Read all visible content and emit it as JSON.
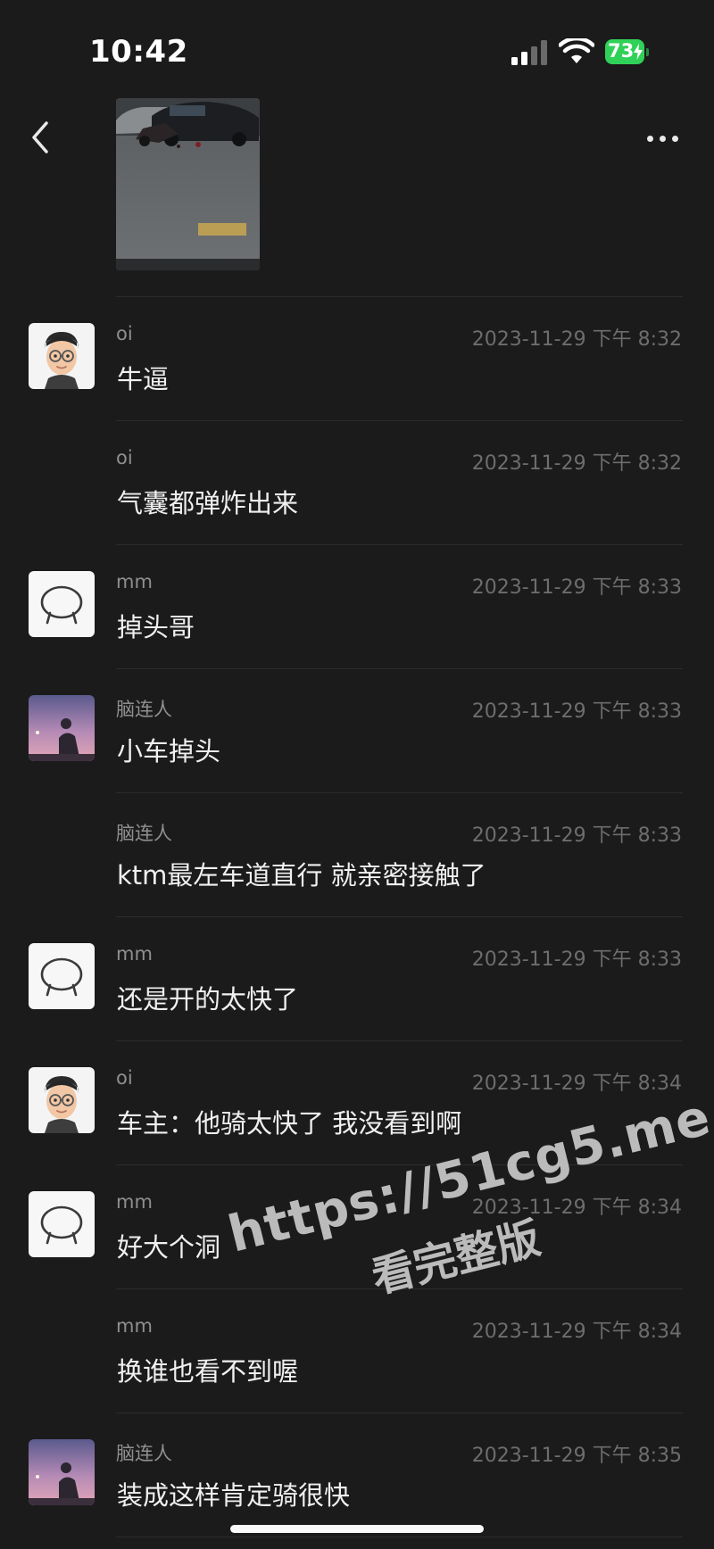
{
  "status_bar": {
    "time": "10:42",
    "battery_percent": "73"
  },
  "header": {
    "back_icon": "chevron-left-icon",
    "more_icon": "ellipsis-icon"
  },
  "post": {
    "image_subject": "car accident scene"
  },
  "comments": [
    {
      "sender": "oi",
      "avatar": "memoji-glasses",
      "timestamp": "2023-11-29 下午 8:32",
      "text": "牛逼",
      "show_avatar": true
    },
    {
      "sender": "oi",
      "avatar": "",
      "timestamp": "2023-11-29 下午 8:32",
      "text": "气囊都弹炸出来",
      "show_avatar": false
    },
    {
      "sender": "mm",
      "avatar": "speech-bubble",
      "timestamp": "2023-11-29 下午 8:33",
      "text": "掉头哥",
      "show_avatar": true
    },
    {
      "sender": "脑连人",
      "avatar": "sunset-photo",
      "timestamp": "2023-11-29 下午 8:33",
      "text": "小车掉头",
      "show_avatar": true
    },
    {
      "sender": "脑连人",
      "avatar": "",
      "timestamp": "2023-11-29 下午 8:33",
      "text": "ktm最左车道直行 就亲密接触了",
      "show_avatar": false
    },
    {
      "sender": "mm",
      "avatar": "speech-bubble",
      "timestamp": "2023-11-29 下午 8:33",
      "text": "还是开的太快了",
      "show_avatar": true
    },
    {
      "sender": "oi",
      "avatar": "memoji-glasses",
      "timestamp": "2023-11-29 下午 8:34",
      "text": "车主：他骑太快了 我没看到啊",
      "show_avatar": true
    },
    {
      "sender": "mm",
      "avatar": "speech-bubble",
      "timestamp": "2023-11-29 下午 8:34",
      "text": "好大个洞",
      "show_avatar": true
    },
    {
      "sender": "mm",
      "avatar": "",
      "timestamp": "2023-11-29 下午 8:34",
      "text": "换谁也看不到喔",
      "show_avatar": false
    },
    {
      "sender": "脑连人",
      "avatar": "sunset-photo",
      "timestamp": "2023-11-29 下午 8:35",
      "text": "装成这样肯定骑很快",
      "show_avatar": true
    }
  ],
  "watermark": {
    "line1": "https://51cg5.me",
    "line2": "看完整版"
  },
  "colors": {
    "background": "#1b1b1b",
    "divider": "#2c2c2c",
    "timestamp": "#6d6d6d",
    "sender": "#8f8f8f",
    "battery": "#30d158"
  }
}
